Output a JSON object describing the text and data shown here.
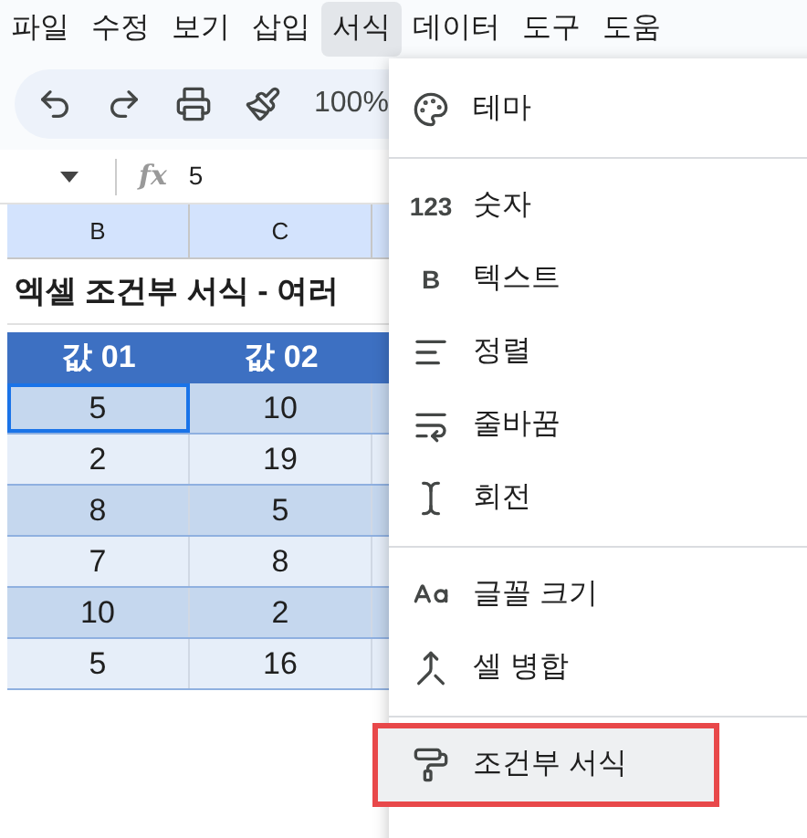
{
  "menu_bar": [
    {
      "label": "파일",
      "selected": false
    },
    {
      "label": "수정",
      "selected": false
    },
    {
      "label": "보기",
      "selected": false
    },
    {
      "label": "삽입",
      "selected": false
    },
    {
      "label": "서식",
      "selected": true
    },
    {
      "label": "데이터",
      "selected": false
    },
    {
      "label": "도구",
      "selected": false
    },
    {
      "label": "도움",
      "selected": false
    }
  ],
  "toolbar": {
    "zoom": "100%"
  },
  "formula_bar": {
    "fx": "fx",
    "value": "5"
  },
  "sheet": {
    "columns": [
      "B",
      "C"
    ],
    "title": "엑셀 조건부 서식 - 여러",
    "header": [
      "값 01",
      "값 02"
    ],
    "rows": [
      {
        "cells": [
          "5",
          "10"
        ],
        "selected": true
      },
      {
        "cells": [
          "2",
          "19"
        ],
        "selected": false
      },
      {
        "cells": [
          "8",
          "5"
        ],
        "selected": false
      },
      {
        "cells": [
          "7",
          "8"
        ],
        "selected": false
      },
      {
        "cells": [
          "10",
          "2"
        ],
        "selected": false
      },
      {
        "cells": [
          "5",
          "16"
        ],
        "selected": false
      }
    ]
  },
  "format_menu": {
    "groups": [
      [
        {
          "label": "테마",
          "highlighted": false
        }
      ],
      [
        {
          "label": "숫자",
          "glyph": "123",
          "highlighted": false
        },
        {
          "label": "텍스트",
          "glyph": "B",
          "highlighted": false
        },
        {
          "label": "정렬",
          "highlighted": false
        },
        {
          "label": "줄바꿈",
          "highlighted": false
        },
        {
          "label": "회전",
          "highlighted": false
        }
      ],
      [
        {
          "label": "글꼴 크기",
          "highlighted": false
        },
        {
          "label": "셀 병합",
          "highlighted": false
        }
      ],
      [
        {
          "label": "조건부 서식",
          "highlighted": true
        }
      ]
    ]
  }
}
